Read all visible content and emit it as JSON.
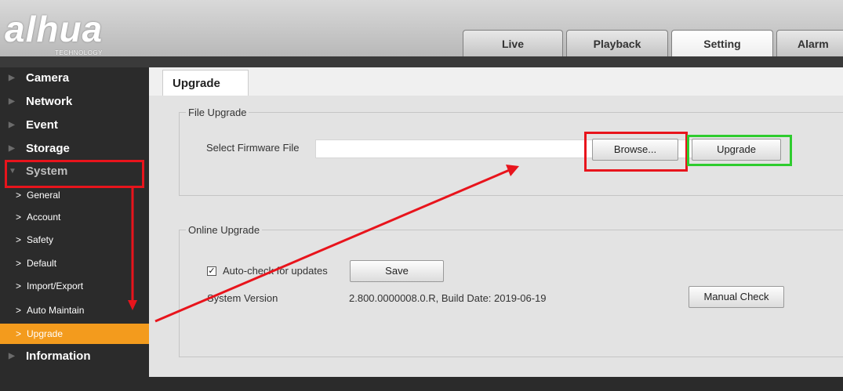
{
  "header": {
    "logo_text": "alhua",
    "logo_sub": "TECHNOLOGY",
    "tabs": [
      {
        "label": "Live"
      },
      {
        "label": "Playback"
      },
      {
        "label": "Setting",
        "active": true
      },
      {
        "label": "Alarm"
      }
    ]
  },
  "sidebar": {
    "items": [
      {
        "label": "Camera"
      },
      {
        "label": "Network"
      },
      {
        "label": "Event"
      },
      {
        "label": "Storage"
      },
      {
        "label": "System",
        "expanded": true
      },
      {
        "label": "Information"
      }
    ],
    "system_children": [
      {
        "label": "General"
      },
      {
        "label": "Account"
      },
      {
        "label": "Safety"
      },
      {
        "label": "Default"
      },
      {
        "label": "Import/Export"
      },
      {
        "label": "Auto Maintain"
      },
      {
        "label": "Upgrade",
        "active": true
      }
    ]
  },
  "content": {
    "tab_label": "Upgrade",
    "file_upgrade": {
      "legend": "File Upgrade",
      "select_label": "Select Firmware File",
      "file_value": "",
      "browse_label": "Browse...",
      "upgrade_label": "Upgrade"
    },
    "online_upgrade": {
      "legend": "Online Upgrade",
      "auto_check_label": "Auto-check for updates",
      "auto_check_checked": true,
      "save_label": "Save",
      "version_label": "System Version",
      "version_value": "2.800.0000008.0.R, Build Date: 2019-06-19",
      "manual_check_label": "Manual Check"
    }
  },
  "colors": {
    "sidebar_bg": "#2b2b2b",
    "active_item": "#f39b1d",
    "highlight_red": "#e8141c",
    "highlight_green": "#2ecc2e",
    "arrow_red": "#e8141c"
  }
}
